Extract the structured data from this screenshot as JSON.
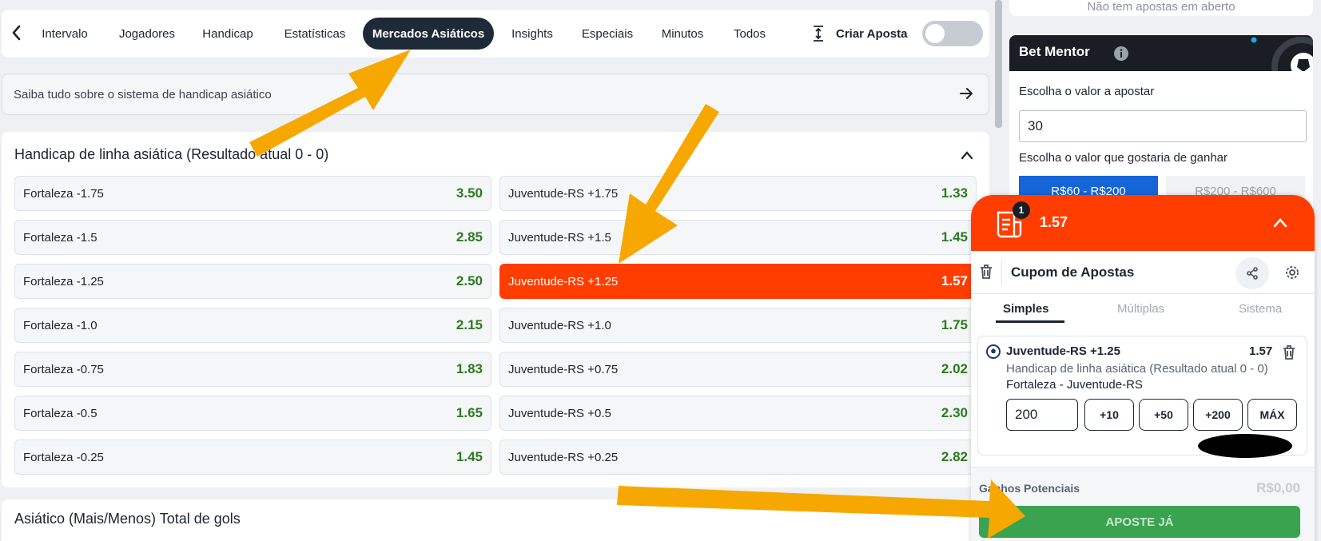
{
  "tabs": {
    "items": [
      "Intervalo",
      "Jogadores",
      "Handicap",
      "Estatísticas",
      "Mercados Asiáticos",
      "Insights",
      "Especiais",
      "Minutos",
      "Todos"
    ],
    "active": "Mercados Asiáticos",
    "bet_builder_label": "Criar Aposta"
  },
  "info_banner": "Saiba tudo sobre o sistema de handicap asiático",
  "market": {
    "title": "Handicap de linha asiática (Resultado atual 0 - 0)",
    "home": [
      {
        "label": "Fortaleza -1.75",
        "odd": "3.50"
      },
      {
        "label": "Fortaleza -1.5",
        "odd": "2.85"
      },
      {
        "label": "Fortaleza -1.25",
        "odd": "2.50"
      },
      {
        "label": "Fortaleza -1.0",
        "odd": "2.15"
      },
      {
        "label": "Fortaleza -0.75",
        "odd": "1.83"
      },
      {
        "label": "Fortaleza -0.5",
        "odd": "1.65"
      },
      {
        "label": "Fortaleza -0.25",
        "odd": "1.45"
      }
    ],
    "away": [
      {
        "label": "Juventude-RS +1.75",
        "odd": "1.33"
      },
      {
        "label": "Juventude-RS +1.5",
        "odd": "1.45"
      },
      {
        "label": "Juventude-RS +1.25",
        "odd": "1.57"
      },
      {
        "label": "Juventude-RS +1.0",
        "odd": "1.75"
      },
      {
        "label": "Juventude-RS +0.75",
        "odd": "2.02"
      },
      {
        "label": "Juventude-RS +0.5",
        "odd": "2.30"
      },
      {
        "label": "Juventude-RS +0.25",
        "odd": "2.82"
      }
    ],
    "selected_away_index": 2
  },
  "market2_title": "Asiático (Mais/Menos) Total de gols",
  "no_open_bets": "Não tem apostas em aberto",
  "bet_mentor": {
    "title": "Bet Mentor",
    "stake_label": "Escolha o valor a apostar",
    "stake_value": "30",
    "win_label": "Escolha o valor que gostaria de ganhar",
    "ranges": [
      "R$60 - R$200",
      "R$200 - R$600"
    ]
  },
  "bet_slip": {
    "count": "1",
    "total_odd": "1.57",
    "title": "Cupom de Apostas",
    "tabs": [
      "Simples",
      "Múltiplas",
      "Sistema"
    ],
    "selection": "Juventude-RS +1.25",
    "selection_odd": "1.57",
    "market": "Handicap de linha asiática (Resultado atual 0 - 0)",
    "match": "Fortaleza - Juventude-RS",
    "stake": "200",
    "quick_amounts": [
      "+10",
      "+50",
      "+200",
      "MÁX"
    ],
    "potential_label": "Ganhos Potenciais",
    "potential_value": "R$0,00",
    "place_bet": "APOSTE JÁ"
  },
  "colors": {
    "accent": "#ff3d00",
    "odd_green": "#2c7a1f",
    "tab_active": "#1e2a38",
    "range_active": "#1565d8",
    "place_bet": "#3aa34f",
    "annotation_arrows": "#f7a800"
  }
}
